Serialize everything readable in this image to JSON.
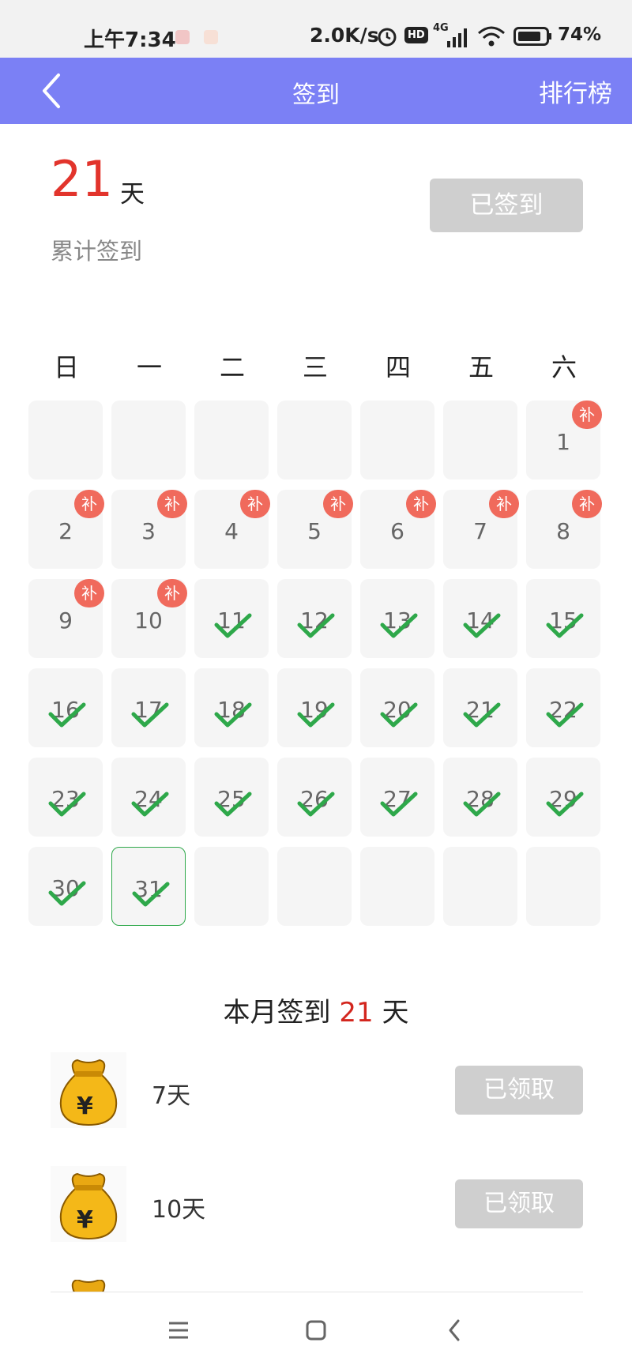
{
  "status_bar": {
    "time": "上午7:34",
    "net_speed": "2.0K/s",
    "network_type": "4G",
    "hd_badge": "HD",
    "battery": "74%"
  },
  "header": {
    "title": "签到",
    "right_action": "排行榜",
    "back_icon": "chevron-left-icon"
  },
  "summary": {
    "total_days": "21",
    "unit": "天",
    "label": "累计签到",
    "signed_button": "已签到"
  },
  "calendar": {
    "weekdays": [
      "日",
      "一",
      "二",
      "三",
      "四",
      "五",
      "六"
    ],
    "makeup_label": "补",
    "days": [
      {
        "day": "1",
        "state": "makeup"
      },
      {
        "day": "2",
        "state": "makeup"
      },
      {
        "day": "3",
        "state": "makeup"
      },
      {
        "day": "4",
        "state": "makeup"
      },
      {
        "day": "5",
        "state": "makeup"
      },
      {
        "day": "6",
        "state": "makeup"
      },
      {
        "day": "7",
        "state": "makeup"
      },
      {
        "day": "8",
        "state": "makeup"
      },
      {
        "day": "9",
        "state": "makeup"
      },
      {
        "day": "10",
        "state": "makeup"
      },
      {
        "day": "11",
        "state": "signed"
      },
      {
        "day": "12",
        "state": "signed"
      },
      {
        "day": "13",
        "state": "signed"
      },
      {
        "day": "14",
        "state": "signed"
      },
      {
        "day": "15",
        "state": "signed"
      },
      {
        "day": "16",
        "state": "signed"
      },
      {
        "day": "17",
        "state": "signed"
      },
      {
        "day": "18",
        "state": "signed"
      },
      {
        "day": "19",
        "state": "signed"
      },
      {
        "day": "20",
        "state": "signed"
      },
      {
        "day": "21",
        "state": "signed"
      },
      {
        "day": "22",
        "state": "signed"
      },
      {
        "day": "23",
        "state": "signed"
      },
      {
        "day": "24",
        "state": "signed"
      },
      {
        "day": "25",
        "state": "signed"
      },
      {
        "day": "26",
        "state": "signed"
      },
      {
        "day": "27",
        "state": "signed"
      },
      {
        "day": "28",
        "state": "signed"
      },
      {
        "day": "29",
        "state": "signed"
      },
      {
        "day": "30",
        "state": "signed"
      },
      {
        "day": "31",
        "state": "signed",
        "today": true
      }
    ],
    "first_weekday_index": 6
  },
  "month_summary": {
    "prefix": "本月签到",
    "count": "21",
    "suffix": "天"
  },
  "rewards": [
    {
      "label": "7天",
      "button": "已领取",
      "icon": "money-bag-icon"
    },
    {
      "label": "10天",
      "button": "已领取",
      "icon": "money-bag-icon"
    }
  ],
  "colors": {
    "header_bg": "#7b80f5",
    "accent_red": "#e2342c",
    "check_green": "#2ea84a",
    "makeup_badge": "#f06a5c",
    "disabled_button": "#cfcfcf"
  },
  "nav": {
    "menu_icon": "menu-icon",
    "home_icon": "home-square-icon",
    "back_icon": "back-triangle-icon"
  }
}
